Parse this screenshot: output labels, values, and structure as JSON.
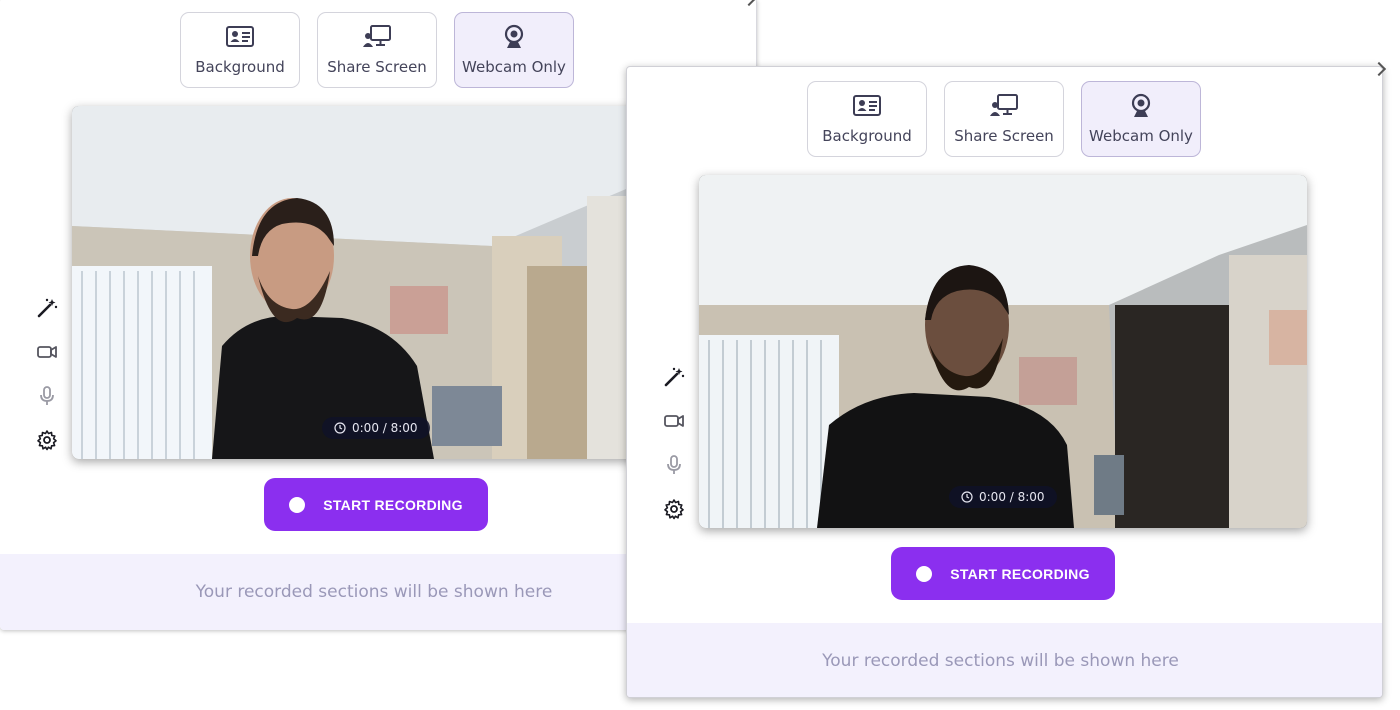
{
  "windows": [
    {
      "modes": [
        {
          "label": "Background",
          "icon": "id-card-icon",
          "active": false
        },
        {
          "label": "Share Screen",
          "icon": "share-screen-icon",
          "active": false
        },
        {
          "label": "Webcam Only",
          "icon": "webcam-icon",
          "active": true
        }
      ],
      "tools": [
        "magic-wand-icon",
        "camera-icon",
        "microphone-icon",
        "gear-icon"
      ],
      "timer": "0:00 / 8:00",
      "record_label": "START RECORDING",
      "sections_placeholder": "Your recorded sections will be shown here"
    },
    {
      "modes": [
        {
          "label": "Background",
          "icon": "id-card-icon",
          "active": false
        },
        {
          "label": "Share Screen",
          "icon": "share-screen-icon",
          "active": false
        },
        {
          "label": "Webcam Only",
          "icon": "webcam-icon",
          "active": true
        }
      ],
      "tools": [
        "magic-wand-icon",
        "camera-icon",
        "microphone-icon",
        "gear-icon"
      ],
      "timer": "0:00 / 8:00",
      "record_label": "START RECORDING",
      "sections_placeholder": "Your recorded sections will be shown here"
    }
  ],
  "colors": {
    "accent": "#8b2fef",
    "active_mode_bg": "#f1eefb",
    "sections_bg": "#f3f1fd",
    "placeholder_text": "#9a98b8"
  }
}
